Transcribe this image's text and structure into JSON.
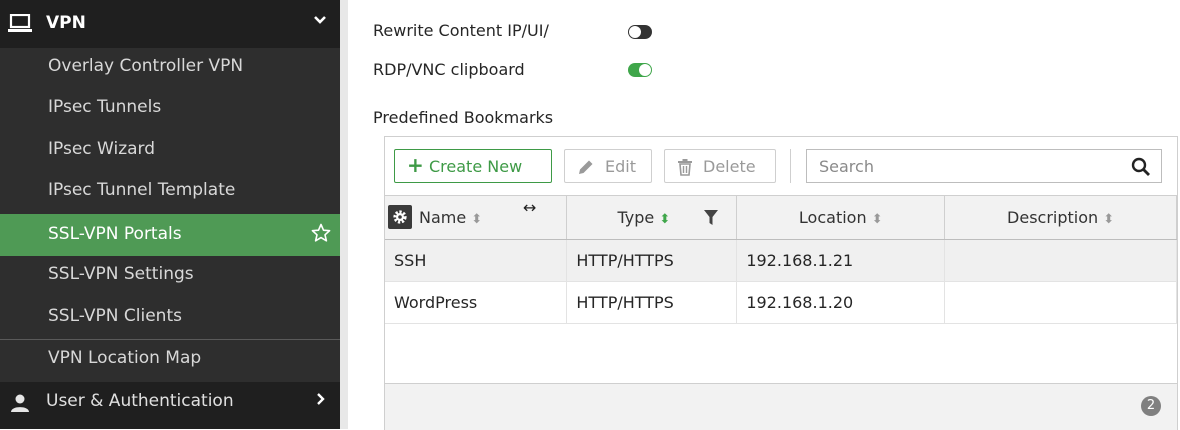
{
  "sidebar": {
    "section": {
      "label": "VPN",
      "icon": "laptop-icon",
      "expanded": true
    },
    "items": [
      {
        "label": "Overlay Controller VPN"
      },
      {
        "label": "IPsec Tunnels"
      },
      {
        "label": "IPsec Wizard"
      },
      {
        "label": "IPsec Tunnel Template"
      },
      {
        "label": "SSL-VPN Portals",
        "active": true,
        "icon": "star-icon"
      },
      {
        "label": "SSL-VPN Settings"
      },
      {
        "label": "SSL-VPN Clients"
      },
      {
        "label": "VPN Location Map"
      }
    ],
    "next_section": {
      "label": "User & Authentication",
      "icon": "user-icon"
    }
  },
  "settings": {
    "rewrite": {
      "label": "Rewrite Content IP/UI/",
      "enabled": false
    },
    "rdp_clipboard": {
      "label": "RDP/VNC clipboard",
      "enabled": true
    }
  },
  "bookmarks": {
    "title": "Predefined Bookmarks",
    "toolbar": {
      "create_label": "Create New",
      "edit_label": "Edit",
      "delete_label": "Delete",
      "search_placeholder": "Search"
    },
    "columns": [
      "Name",
      "Type",
      "Location",
      "Description"
    ],
    "rows": [
      {
        "name": "SSH",
        "type": "HTTP/HTTPS",
        "location": "192.168.1.21",
        "description": ""
      },
      {
        "name": "WordPress",
        "type": "HTTP/HTTPS",
        "location": "192.168.1.20",
        "description": ""
      }
    ],
    "count": "2"
  },
  "colors": {
    "accent": "#4f9a55",
    "toggle_on": "#3fa64a",
    "sidebar_bg": "#2e2e2e"
  }
}
